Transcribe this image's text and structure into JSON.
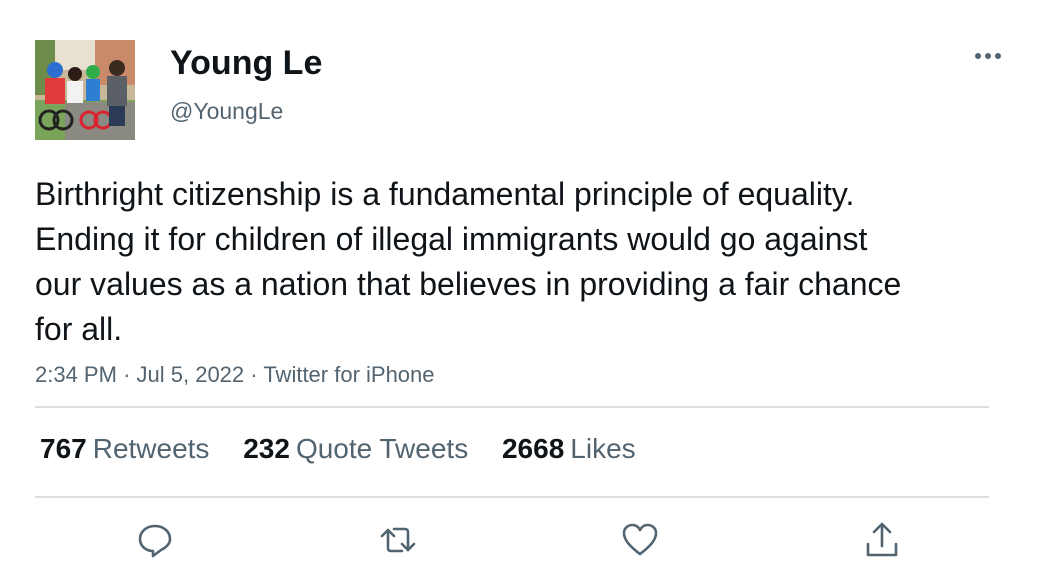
{
  "tweet": {
    "author": {
      "display_name": "Young Le",
      "handle": "@YoungLe",
      "avatar_icon": "family-photo-avatar"
    },
    "text": "Birthright citizenship is a fundamental principle of equality. Ending it for children of illegal immigrants would go against our values as a nation that believes in providing a fair chance for all.",
    "meta": {
      "time": "2:34 PM",
      "date": "Jul 5, 2022",
      "source": "Twitter for iPhone",
      "separator": "·"
    },
    "stats": {
      "retweets": {
        "count": "767",
        "label": "Retweets"
      },
      "quote_tweets": {
        "count": "232",
        "label": "Quote Tweets"
      },
      "likes": {
        "count": "2668",
        "label": "Likes"
      }
    },
    "actions": {
      "reply_icon": "reply-icon",
      "retweet_icon": "retweet-icon",
      "like_icon": "heart-icon",
      "share_icon": "share-icon",
      "more_icon": "more-options-icon"
    },
    "colors": {
      "text_primary": "#0f1419",
      "text_secondary": "#536471",
      "icon": "#536471",
      "divider": "#dcdfe2"
    }
  }
}
